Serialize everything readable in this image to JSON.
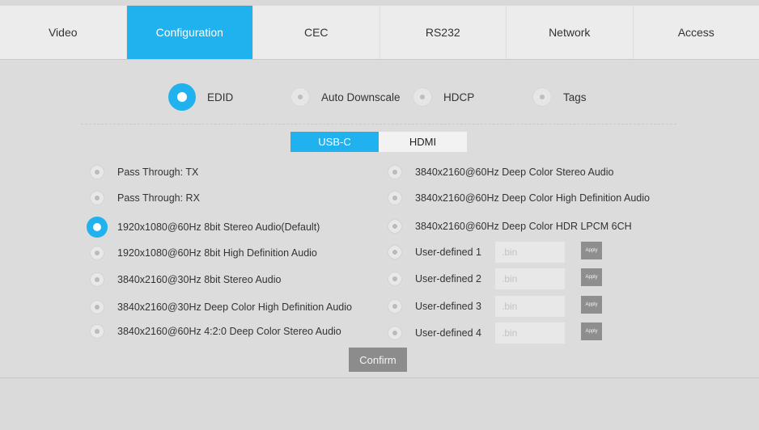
{
  "tabs": [
    {
      "label": "Video"
    },
    {
      "label": "Configuration"
    },
    {
      "label": "CEC"
    },
    {
      "label": "RS232"
    },
    {
      "label": "Network"
    },
    {
      "label": "Access"
    }
  ],
  "active_tab": "Configuration",
  "modes": [
    {
      "label": "EDID",
      "selected": true
    },
    {
      "label": "Auto Downscale",
      "selected": false
    },
    {
      "label": "HDCP",
      "selected": false
    },
    {
      "label": "Tags",
      "selected": false
    }
  ],
  "source_toggle": {
    "options": [
      "USB-C",
      "HDMI"
    ],
    "active": "USB-C"
  },
  "left_options": [
    {
      "label": "Pass Through: TX",
      "selected": false
    },
    {
      "label": "Pass Through: RX",
      "selected": false
    },
    {
      "label": "1920x1080@60Hz 8bit Stereo Audio(Default)",
      "selected": true
    },
    {
      "label": "1920x1080@60Hz 8bit High Definition Audio",
      "selected": false
    },
    {
      "label": "3840x2160@30Hz 8bit Stereo Audio",
      "selected": false
    },
    {
      "label": "3840x2160@30Hz Deep Color High Definition Audio",
      "selected": false
    },
    {
      "label": "3840x2160@60Hz 4:2:0 Deep Color Stereo Audio",
      "selected": false
    }
  ],
  "right_options": [
    {
      "label": "3840x2160@60Hz Deep Color Stereo Audio",
      "selected": false
    },
    {
      "label": "3840x2160@60Hz Deep Color High Definition Audio",
      "selected": false
    },
    {
      "label": "3840x2160@60Hz Deep Color HDR LPCM 6CH",
      "selected": false
    }
  ],
  "user_defined": [
    {
      "label": "User-defined 1",
      "placeholder": ".bin",
      "apply_label": "Apply"
    },
    {
      "label": "User-defined 2",
      "placeholder": ".bin",
      "apply_label": "Apply"
    },
    {
      "label": "User-defined 3",
      "placeholder": ".bin",
      "apply_label": "Apply"
    },
    {
      "label": "User-defined 4",
      "placeholder": ".bin",
      "apply_label": "Apply"
    }
  ],
  "confirm_label": "Confirm",
  "colors": {
    "accent": "#1fb2ee",
    "panel": "#dcdcdc",
    "button": "#8c8c8c"
  }
}
